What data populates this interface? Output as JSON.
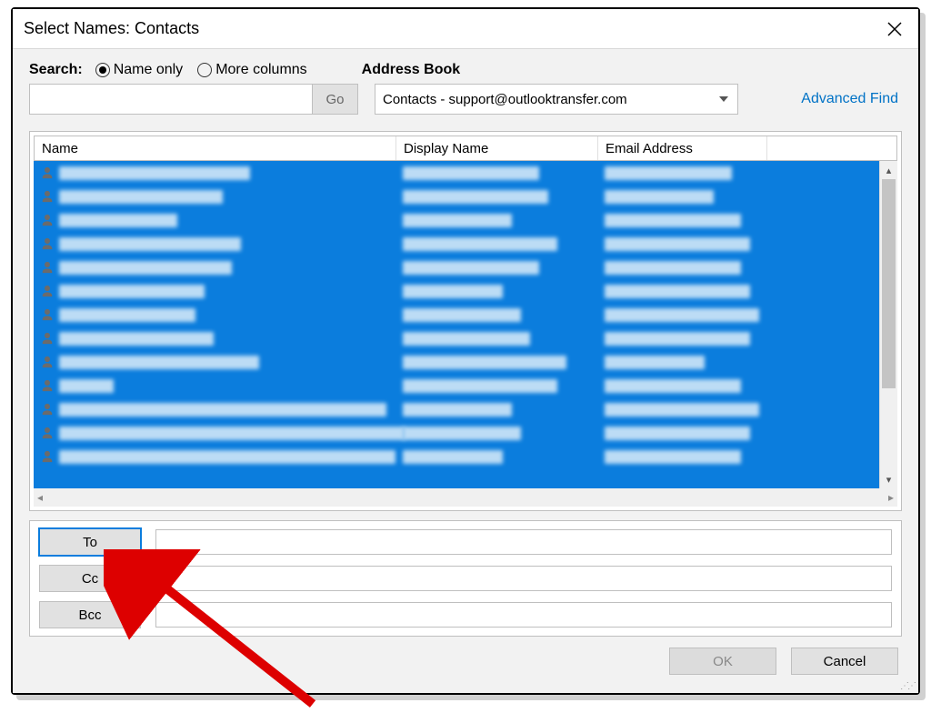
{
  "title": "Select Names: Contacts",
  "search": {
    "label": "Search:",
    "name_only": "Name only",
    "more_columns": "More columns",
    "go": "Go",
    "value": ""
  },
  "address_book": {
    "label": "Address Book",
    "selected": "Contacts - support@outlooktransfer.com",
    "advanced": "Advanced Find"
  },
  "columns": {
    "name": "Name",
    "display": "Display Name",
    "email": "Email Address"
  },
  "recipients": {
    "to": "To",
    "cc": "Cc",
    "bcc": "Bcc"
  },
  "footer": {
    "ok": "OK",
    "cancel": "Cancel"
  },
  "contacts_redacted": true,
  "contact_row_count": 13
}
